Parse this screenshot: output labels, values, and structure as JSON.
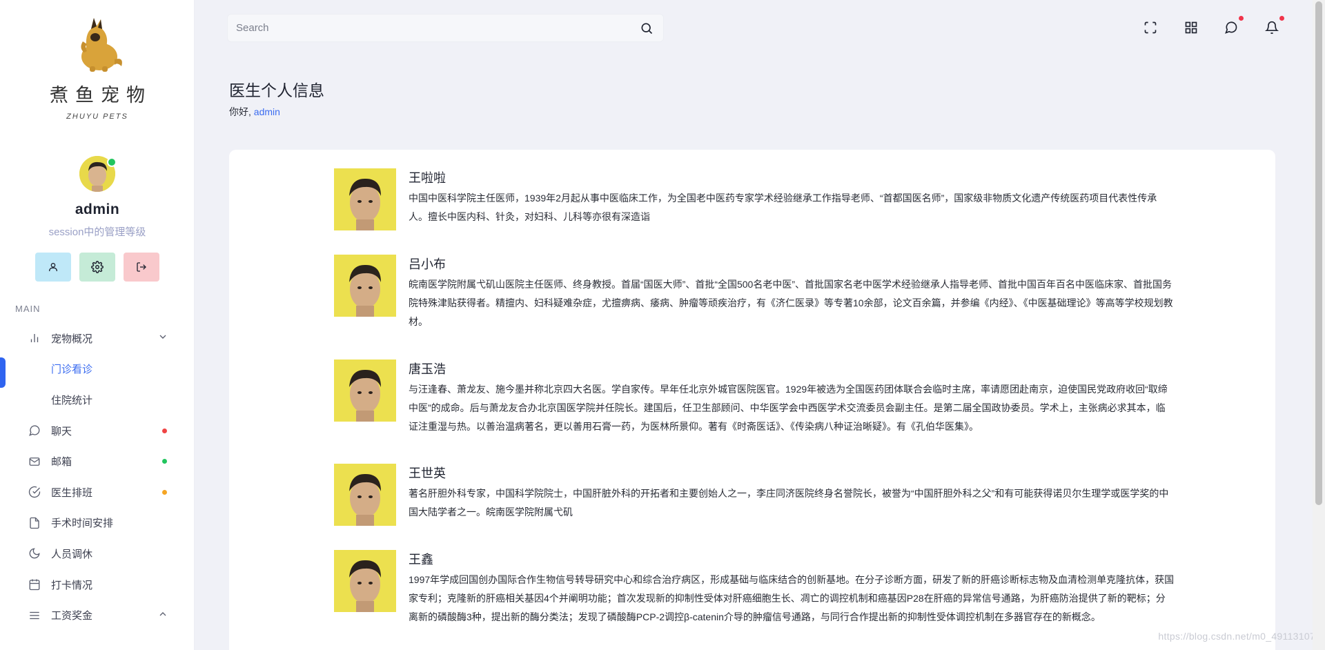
{
  "brand": {
    "title": "煮鱼宠物",
    "subtitle": "ZHUYU PETS"
  },
  "profile": {
    "name": "admin",
    "role": "session中的管理等级",
    "online_color": "#22c55e"
  },
  "sidebar": {
    "section_label": "MAIN",
    "items": [
      {
        "label": "宠物概况",
        "icon": "bar-chart-icon"
      },
      {
        "label": "门诊看诊"
      },
      {
        "label": "住院统计"
      },
      {
        "label": "聊天",
        "icon": "chat-icon",
        "dot_color": "#ef4444"
      },
      {
        "label": "邮箱",
        "icon": "mail-icon",
        "dot_color": "#22c55e"
      },
      {
        "label": "医生排班",
        "icon": "check-circle-icon",
        "dot_color": "#f5a524"
      },
      {
        "label": "手术时间安排",
        "icon": "file-icon"
      },
      {
        "label": "人员调休",
        "icon": "moon-icon"
      },
      {
        "label": "打卡情况",
        "icon": "calendar-icon"
      },
      {
        "label": "工资奖金",
        "icon": "menu-icon"
      }
    ],
    "active_color": "#2f64f0"
  },
  "search": {
    "placeholder": "Search"
  },
  "header": {
    "title": "医生个人信息",
    "greeting_prefix": "你好,",
    "greeting_user": "admin"
  },
  "doctors": [
    {
      "name": "王啦啦",
      "bio": "中国中医科学院主任医师，1939年2月起从事中医临床工作，为全国老中医药专家学术经验继承工作指导老师、“首都国医名师”，国家级非物质文化遗产传统医药项目代表性传承人。擅长中医内科、针灸，对妇科、儿科等亦很有深造诣"
    },
    {
      "name": "吕小布",
      "bio": "皖南医学院附属弋矶山医院主任医师、终身教授。首届“国医大师”、首批“全国500名老中医”、首批国家名老中医学术经验继承人指导老师、首批中国百年百名中医临床家、首批国务院特殊津贴获得者。精擅内、妇科疑难杂症，尤擅痹病、痿病、肿瘤等顽疾治疗，有《济仁医录》等专著10余部，论文百余篇，并参编《内经》、《中医基础理论》等高等学校规划教材。"
    },
    {
      "name": "唐玉浩",
      "bio": "与汪逢春、萧龙友、施今墨并称北京四大名医。学自家传。早年任北京外城官医院医官。1929年被选为全国医药团体联合会临时主席，率请愿团赴南京，迫使国民党政府收回“取缔中医”的成命。后与萧龙友合办北京国医学院并任院长。建国后，任卫生部顾问、中华医学会中西医学术交流委员会副主任。是第二届全国政协委员。学术上，主张病必求其本，临证注重湿与热。以善治温病著名，更以善用石膏一药，为医林所景仰。著有《时斋医话》、《传染病八种证治晰疑》。有《孔伯华医集》。"
    },
    {
      "name": "王世英",
      "bio": "著名肝胆外科专家，中国科学院院士，中国肝脏外科的开拓者和主要创始人之一，李庄同济医院终身名誉院长，被誉为“中国肝胆外科之父”和有可能获得诺贝尔生理学或医学奖的中国大陆学者之一。皖南医学院附属弋矶"
    },
    {
      "name": "王鑫",
      "bio": "1997年学成回国创办国际合作生物信号转导研究中心和综合治疗病区，形成基础与临床结合的创新基地。在分子诊断方面，研发了新的肝癌诊断标志物及血清检测单克隆抗体，获国家专利；克隆新的肝癌相关基因4个并阐明功能；首次发现新的抑制性受体对肝癌细胞生长、凋亡的调控机制和癌基因P28在肝癌的异常信号通路，为肝癌防治提供了新的靶标；分离新的磷酸酶3种，提出新的酶分类法；发现了磷酸酶PCP-2调控β-catenin介导的肿瘤信号通路，与同行合作提出新的抑制性受体调控机制在多器官存在的新概念。"
    }
  ],
  "watermark": "https://blog.csdn.net/m0_49113107",
  "colors": {
    "accent": "#3b6cf0",
    "notify": "#f0344a"
  }
}
